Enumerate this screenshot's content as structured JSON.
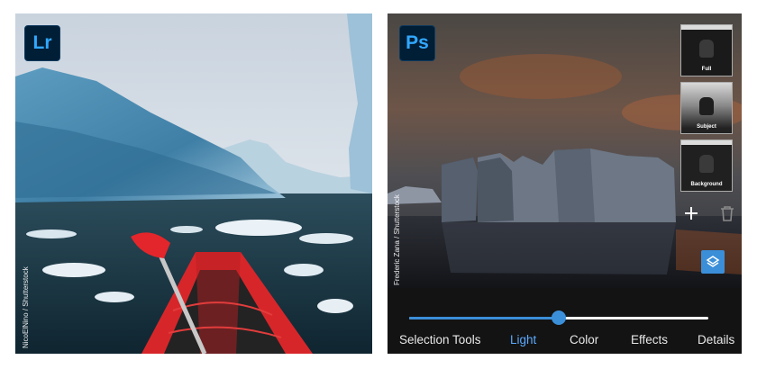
{
  "left_panel": {
    "app_badge": "Lr",
    "photo_credit": "NicoElNino / Shutterstock"
  },
  "right_panel": {
    "app_badge": "Ps",
    "photo_credit": "Frederic Zana / Shutterstock",
    "layers": [
      {
        "label": "Full"
      },
      {
        "label": "Subject"
      },
      {
        "label": "Background"
      }
    ],
    "add_icon": "plus-icon",
    "delete_icon": "trash-icon",
    "layers_icon": "layers-icon",
    "slider_value": 0.5,
    "tabs": [
      {
        "label": "Selection Tools"
      },
      {
        "label": "Light",
        "active": true
      },
      {
        "label": "Color"
      },
      {
        "label": "Effects"
      },
      {
        "label": "Details"
      }
    ],
    "accent_color": "#3b8fd9"
  }
}
